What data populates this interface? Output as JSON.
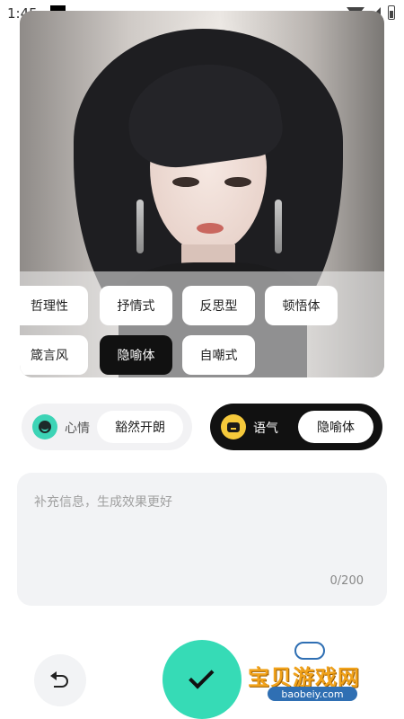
{
  "status_bar": {
    "time": "1:45"
  },
  "style_tags": {
    "row1": [
      "哲理性",
      "抒情式",
      "反思型",
      "顿悟体"
    ],
    "row2": [
      "箴言风",
      "隐喻体",
      "自嘲式"
    ],
    "selected": "隐喻体"
  },
  "mood": {
    "label": "心情",
    "value": "豁然开朗",
    "accent": "#3dd4b6"
  },
  "tone": {
    "label": "语气",
    "value": "隐喻体",
    "accent": "#f5c93b"
  },
  "info_input": {
    "placeholder": "补充信息，生成效果更好",
    "counter": "0/200"
  },
  "actions": {
    "confirm_color": "#36dbb6",
    "undo_icon": "undo-icon",
    "confirm_icon": "check-icon"
  },
  "watermark": {
    "title": "宝贝游戏网",
    "url": "baobeiy.com"
  }
}
